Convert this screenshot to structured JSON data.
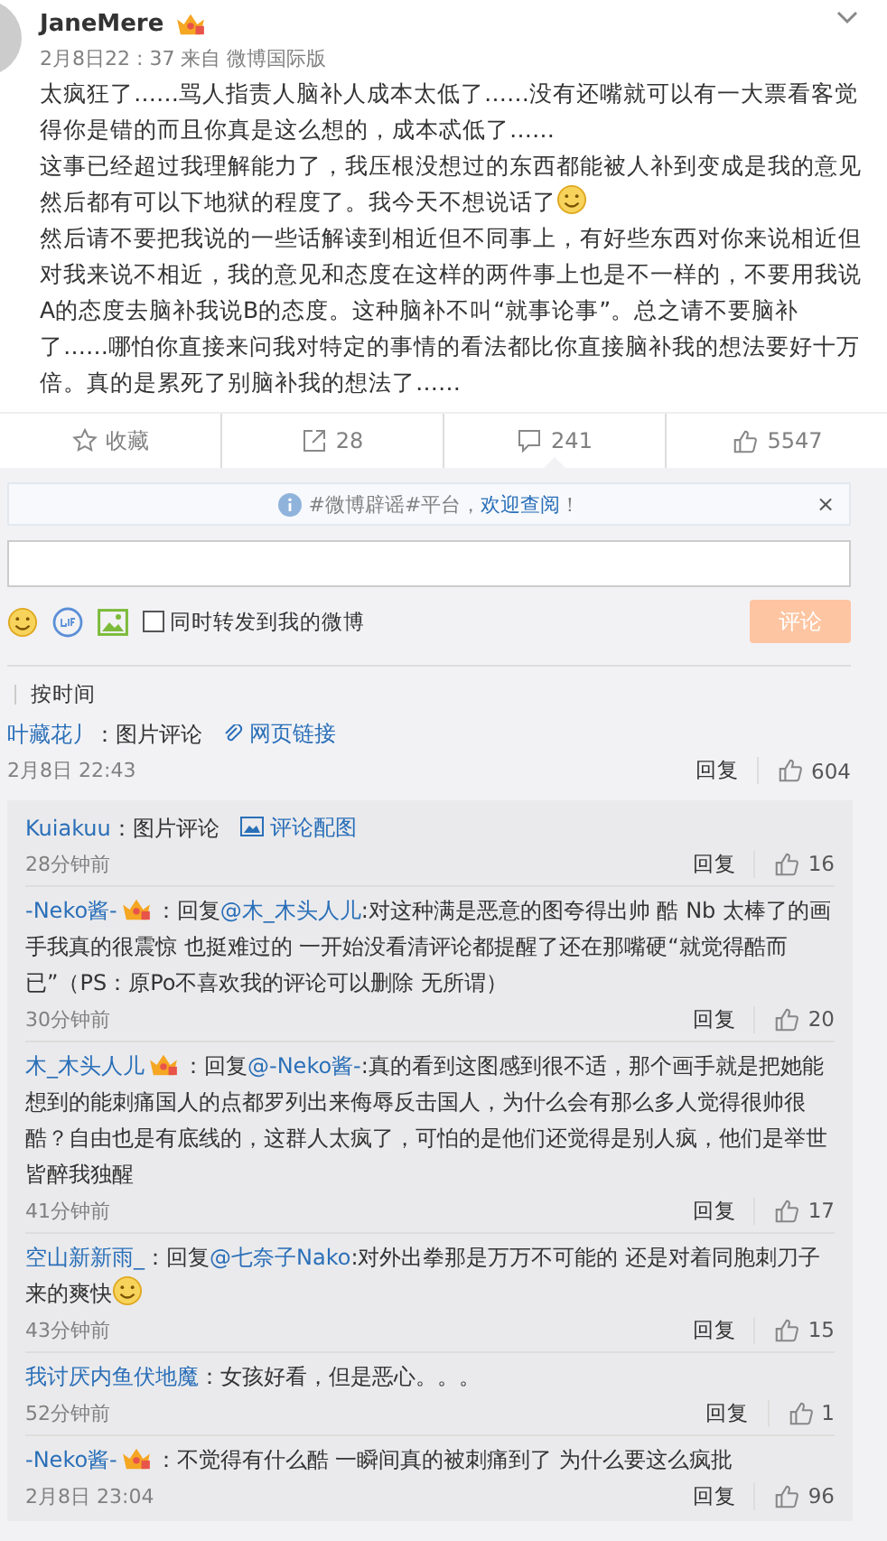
{
  "post": {
    "user": "JaneMere",
    "vip": true,
    "meta": "2月8日22 : 37 来自 微博国际版",
    "paragraphs": [
      {
        "text": "太疯狂了……骂人指责人脑补人成本太低了……没有还嘴就可以有一大票看客觉得你是错的而且你真是这么想的，成本忒低了……",
        "emoji_after": false
      },
      {
        "text": "这事已经超过我理解能力了，我压根没想过的东西都能被人补到变成是我的意见然后都有可以下地狱的程度了。我今天不想说话了",
        "emoji_after": true
      },
      {
        "text": "然后请不要把我说的一些话解读到相近但不同事上，有好些东西对你来说相近但对我来说不相近，我的意见和态度在这样的两件事上也是不一样的，不要用我说A的态度去脑补我说B的态度。这种脑补不叫“就事论事”。总之请不要脑补了……哪怕你直接来问我对特定的事情的看法都比你直接脑补我的想法要好十万倍。真的是累死了别脑补我的想法了……",
        "emoji_after": false
      }
    ]
  },
  "actions": [
    {
      "kind": "favorite",
      "label": "收藏"
    },
    {
      "kind": "repost",
      "label": "28"
    },
    {
      "kind": "comment",
      "label": "241"
    },
    {
      "kind": "like",
      "label": "5547"
    }
  ],
  "notice": {
    "text": "#微博辟谣#平台，",
    "link": "欢迎查阅",
    "tail": "！",
    "close": "×"
  },
  "composer": {
    "repost_label": "同时转发到我的微博",
    "repost_checked": false,
    "submit": "评论"
  },
  "sort": {
    "label": "按时间"
  },
  "top_comment": {
    "user": "叶藏花丿",
    "text": "：图片评论",
    "attachment": {
      "kind": "link",
      "label": "网页链接"
    },
    "time": "2月8日 22:43",
    "reply": "回复",
    "likes": "604"
  },
  "replies": [
    {
      "user": "Kuiakuu",
      "vip": false,
      "text": "：图片评论",
      "attachment": {
        "kind": "image",
        "label": "评论配图"
      },
      "emoji_after": false,
      "time": "28分钟前",
      "reply": "回复",
      "likes": "16"
    },
    {
      "user": "-Neko酱-",
      "vip": true,
      "prefix": "：回复",
      "mention": "@木_木头人儿",
      "text": ":对这种满是恶意的图夸得出帅 酷 Nb 太棒了的画手我真的很震惊 也挺难过的 一开始没看清评论都提醒了还在那嘴硬“就觉得酷而已”（PS：原Po不喜欢我的评论可以删除 无所谓）",
      "emoji_after": false,
      "time": "30分钟前",
      "reply": "回复",
      "likes": "20"
    },
    {
      "user": "木_木头人儿",
      "vip": true,
      "prefix": "：回复",
      "mention": "@-Neko酱-",
      "text": ":真的看到这图感到很不适，那个画手就是把她能想到的能刺痛国人的点都罗列出来侮辱反击国人，为什么会有那么多人觉得很帅很酷？自由也是有底线的，这群人太疯了，可怕的是他们还觉得是别人疯，他们是举世皆醉我独醒",
      "emoji_after": false,
      "time": "41分钟前",
      "reply": "回复",
      "likes": "17"
    },
    {
      "user": "空山新新雨_",
      "vip": false,
      "prefix": "：回复",
      "mention": "@七奈子Nako",
      "text": ":对外出拳那是万万不可能的 还是对着同胞刺刀子来的爽快",
      "emoji_after": true,
      "time": "43分钟前",
      "reply": "回复",
      "likes": "15"
    },
    {
      "user": "我讨厌内鱼伏地魔",
      "vip": false,
      "text": "：女孩好看，但是恶心。。。",
      "emoji_after": false,
      "time": "52分钟前",
      "reply": "回复",
      "likes": "1"
    },
    {
      "user": "-Neko酱-",
      "vip": true,
      "text": "：不觉得有什么酷 一瞬间真的被刺痛到了 为什么要这么疯批",
      "emoji_after": false,
      "time": "2月8日 23:04",
      "reply": "回复",
      "likes": "96"
    }
  ]
}
